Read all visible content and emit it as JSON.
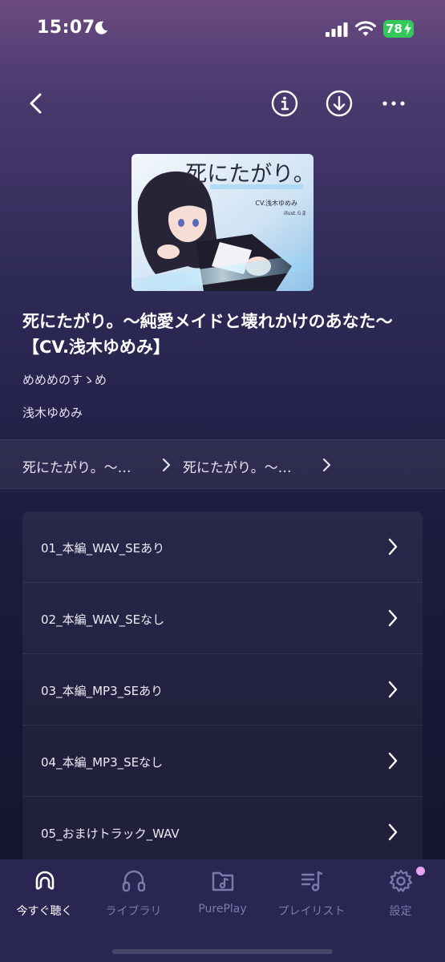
{
  "status_bar": {
    "time": "15:07",
    "battery": "78"
  },
  "nav": {
    "back_icon": "chevron-left-icon",
    "info_icon": "info-icon",
    "download_icon": "download-icon",
    "more_icon": "more-icon"
  },
  "work": {
    "title": "死にたがり。〜純愛メイドと壊れかけのあなた〜【CV.浅木ゆめみ】",
    "circle": "めめめのすゝめ",
    "voice_actor": "浅木ゆめみ",
    "cover": {
      "title": "死にたがり。",
      "cv": "CV.浅木ゆめみ",
      "illust": "illust.らま"
    }
  },
  "breadcrumb": [
    "死にたがり。〜…",
    "死にたがり。〜…"
  ],
  "tracks": [
    "01_本編_WAV_SEあり",
    "02_本編_WAV_SEなし",
    "03_本編_MP3_SEあり",
    "04_本編_MP3_SEなし",
    "05_おまけトラック_WAV"
  ],
  "tabs": [
    {
      "label": "今すぐ聴く",
      "icon": "listen-now-icon"
    },
    {
      "label": "ライブラリ",
      "icon": "headphones-icon"
    },
    {
      "label": "PurePlay",
      "icon": "music-file-icon"
    },
    {
      "label": "プレイリスト",
      "icon": "playlist-icon"
    },
    {
      "label": "設定",
      "icon": "gear-icon"
    }
  ],
  "colors": {
    "accent_active": "#ffffff",
    "tab_inactive": "#7c79ad",
    "battery": "#34c759",
    "notification_dot": "#e7a4f1"
  }
}
